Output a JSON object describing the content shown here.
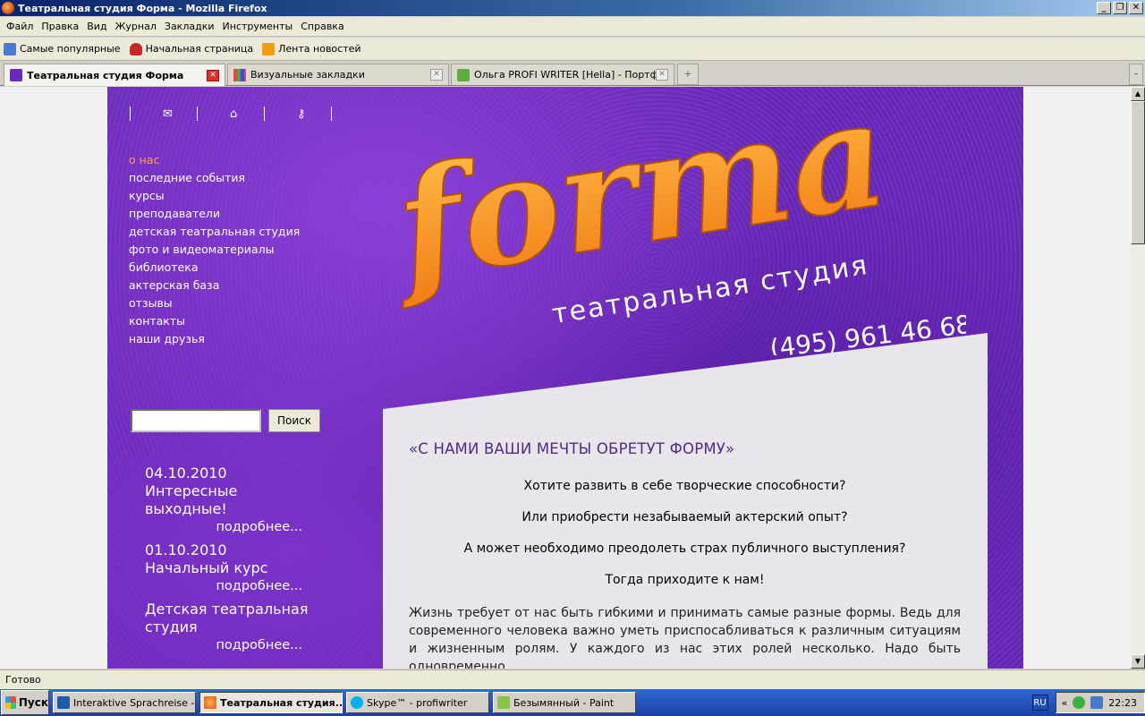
{
  "window": {
    "title": "Театральная студия Форма - Mozilla Firefox",
    "buttons": [
      "_",
      "❐",
      "✕"
    ]
  },
  "menu": [
    "Файл",
    "Правка",
    "Вид",
    "Журнал",
    "Закладки",
    "Инструменты",
    "Справка"
  ],
  "bookmarks": [
    {
      "label": "Самые популярные",
      "icon": "search-icon"
    },
    {
      "label": "Начальная страница",
      "icon": "home-page-icon"
    },
    {
      "label": "Лента новостей",
      "icon": "rss-icon"
    }
  ],
  "tabs": [
    {
      "label": "Театральная студия Форма",
      "active": true,
      "icon": "forma-favicon"
    },
    {
      "label": "Визуальные закладки",
      "active": false,
      "icon": "visual-bookmarks-icon"
    },
    {
      "label": "Ольга PROFI WRITER [Hella] - Портф...",
      "active": false,
      "icon": "profi-writer-icon"
    }
  ],
  "site": {
    "top_icons": [
      "envelope-icon",
      "home-icon",
      "key-icon"
    ],
    "nav": [
      {
        "label": "о нас",
        "active": true
      },
      {
        "label": "последние события",
        "active": false
      },
      {
        "label": "курсы",
        "active": false
      },
      {
        "label": "преподаватели",
        "active": false
      },
      {
        "label": "детская театральная студия",
        "active": false
      },
      {
        "label": "фото и видеоматериалы",
        "active": false
      },
      {
        "label": "библиотека",
        "active": false
      },
      {
        "label": "актерская база",
        "active": false
      },
      {
        "label": "отзывы",
        "active": false
      },
      {
        "label": "контакты",
        "active": false
      },
      {
        "label": "наши друзья",
        "active": false
      }
    ],
    "logo": {
      "word": "forma",
      "subtitle": "театральная студия",
      "phone": "(495) 961 46 68"
    },
    "search": {
      "value": "",
      "button": "Поиск"
    },
    "news": [
      {
        "date": "04.10.2010",
        "title": "Интересные выходные!",
        "more": "подробнее..."
      },
      {
        "date": "01.10.2010",
        "title": "Начальный курс",
        "more": "подробнее..."
      },
      {
        "date": "",
        "title": "Детская театральная студия",
        "more": "подробнее..."
      }
    ],
    "main": {
      "slogan": "«С НАМИ ВАШИ МЕЧТЫ ОБРЕТУТ ФОРМУ»",
      "questions": [
        "Хотите развить в себе творческие способности?",
        "Или приобрести незабываемый актерский опыт?",
        "А может необходимо преодолеть страх публичного выступления?",
        "Тогда приходите к нам!"
      ],
      "paragraph": "Жизнь требует от нас быть гибкими и принимать самые разные формы. Ведь для современного человека важно уметь приспосабливаться к различным ситуациям и жизненным ролям. У каждого из нас этих ролей несколько. Надо быть одновременно"
    }
  },
  "status": "Готово",
  "taskbar": {
    "start": "Пуск",
    "tasks": [
      {
        "label": "Interaktive Sprachreise -...",
        "active": false
      },
      {
        "label": "Театральная студия...",
        "active": true
      },
      {
        "label": "Skype™ - profiwriter",
        "active": false
      },
      {
        "label": "Безымянный - Paint",
        "active": false
      }
    ],
    "lang": "RU",
    "chevron": "«",
    "clock": "22:23"
  },
  "colors": {
    "purple": "#6a28bc",
    "orange": "#ffa04a",
    "slogan": "#4e2a8a"
  }
}
